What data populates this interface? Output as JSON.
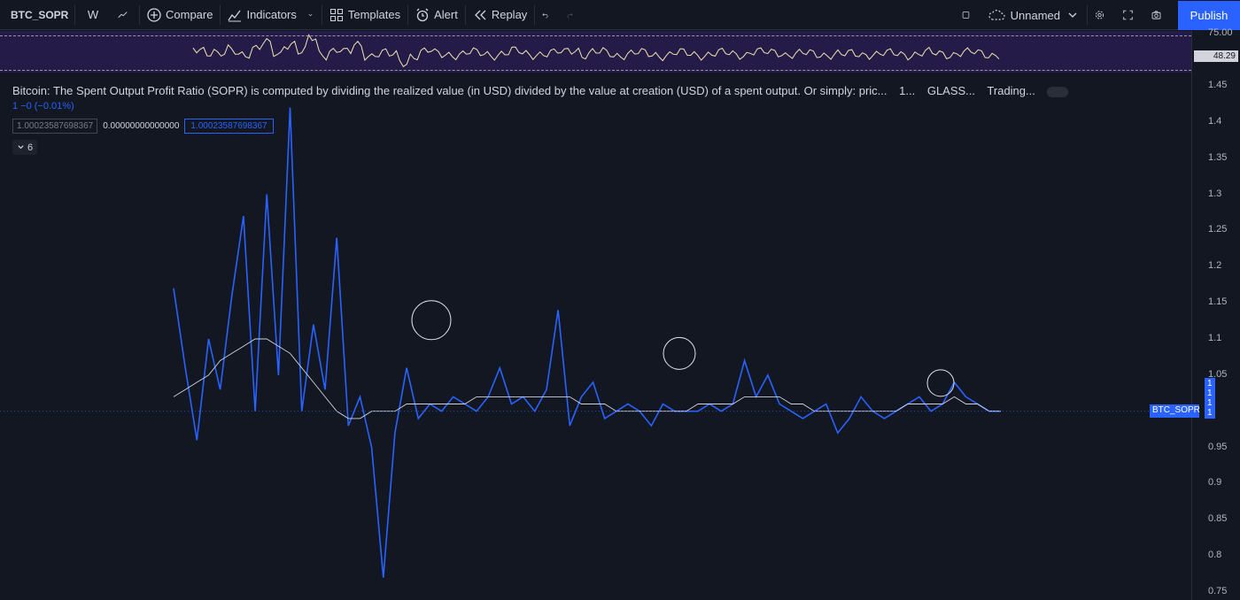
{
  "toolbar": {
    "symbol": "BTC_SOPR",
    "interval": "W",
    "compare": "Compare",
    "indicators": "Indicators",
    "templates": "Templates",
    "alert": "Alert",
    "replay": "Replay",
    "layout_name": "Unnamed",
    "publish": "Publish"
  },
  "legend": {
    "title": "Bitcoin: The Spent Output Profit Ratio (SOPR) is computed by dividing the realized value (in USD) divided by the value at creation (USD) of a spent output. Or simply: pric...",
    "interval": "1...",
    "exchange": "GLASS...",
    "source": "Trading...",
    "change": "1  −0 (−0.01%)",
    "value1": "1.00023587698367",
    "value2": "0.00000000000000",
    "value3": "1.00023587698367",
    "collapsed_count": "6"
  },
  "oscillator": {
    "top_label": "75.00",
    "last_value": "48.29"
  },
  "price_axis": {
    "ticks": [
      "1.45",
      "1.4",
      "1.35",
      "1.3",
      "1.25",
      "1.2",
      "1.15",
      "1.1",
      "1.05",
      "1",
      "0.95",
      "0.9",
      "0.85",
      "0.8",
      "0.75"
    ],
    "symbol_tag": "BTC_SOPR",
    "stacked_tags": [
      "1",
      "1",
      "1",
      "1"
    ]
  },
  "colors": {
    "background": "#131722",
    "series": "#2962ff",
    "ma": "#d1d4dc",
    "osc_bg": "#241b49",
    "accent": "#2962ff"
  },
  "chart_data": {
    "type": "line",
    "title": "BTC_SOPR",
    "ylim": [
      0.75,
      1.45
    ],
    "series": [
      {
        "name": "BTC_SOPR",
        "values": [
          1.17,
          1.06,
          0.96,
          1.1,
          1.03,
          1.16,
          1.27,
          1.0,
          1.3,
          1.05,
          1.42,
          1.0,
          1.12,
          1.03,
          1.24,
          0.98,
          1.02,
          0.95,
          0.77,
          0.97,
          1.06,
          0.99,
          1.01,
          1.0,
          1.02,
          1.01,
          1.0,
          1.02,
          1.06,
          1.01,
          1.02,
          1.0,
          1.03,
          1.14,
          0.98,
          1.02,
          1.04,
          0.99,
          1.0,
          1.01,
          1.0,
          0.98,
          1.01,
          1.0,
          1.0,
          1.0,
          1.01,
          1.0,
          1.01,
          1.07,
          1.02,
          1.05,
          1.01,
          1.0,
          0.99,
          1.0,
          1.01,
          0.97,
          0.99,
          1.02,
          1.0,
          0.99,
          1.0,
          1.01,
          1.02,
          1.0,
          1.01,
          1.04,
          1.02,
          1.01,
          1.0,
          1.0
        ]
      },
      {
        "name": "MA",
        "values": [
          1.02,
          1.03,
          1.04,
          1.05,
          1.07,
          1.08,
          1.09,
          1.1,
          1.1,
          1.09,
          1.08,
          1.06,
          1.04,
          1.02,
          1.0,
          0.99,
          0.99,
          1.0,
          1.0,
          1.0,
          1.01,
          1.01,
          1.01,
          1.01,
          1.01,
          1.01,
          1.02,
          1.02,
          1.02,
          1.02,
          1.02,
          1.02,
          1.02,
          1.02,
          1.02,
          1.01,
          1.01,
          1.01,
          1.0,
          1.0,
          1.0,
          1.0,
          1.0,
          1.0,
          1.0,
          1.01,
          1.01,
          1.01,
          1.01,
          1.02,
          1.02,
          1.02,
          1.02,
          1.01,
          1.01,
          1.0,
          1.0,
          1.0,
          1.0,
          1.0,
          1.0,
          1.0,
          1.0,
          1.01,
          1.01,
          1.01,
          1.01,
          1.02,
          1.01,
          1.01,
          1.0,
          1.0
        ]
      }
    ]
  }
}
